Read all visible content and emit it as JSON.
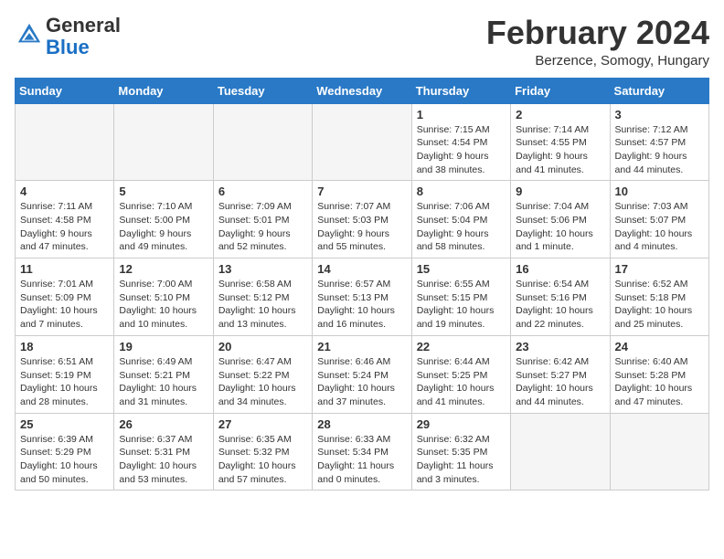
{
  "header": {
    "logo_line1": "General",
    "logo_line2": "Blue",
    "month_title": "February 2024",
    "location": "Berzence, Somogy, Hungary"
  },
  "weekdays": [
    "Sunday",
    "Monday",
    "Tuesday",
    "Wednesday",
    "Thursday",
    "Friday",
    "Saturday"
  ],
  "weeks": [
    [
      {
        "day": "",
        "info": ""
      },
      {
        "day": "",
        "info": ""
      },
      {
        "day": "",
        "info": ""
      },
      {
        "day": "",
        "info": ""
      },
      {
        "day": "1",
        "info": "Sunrise: 7:15 AM\nSunset: 4:54 PM\nDaylight: 9 hours\nand 38 minutes."
      },
      {
        "day": "2",
        "info": "Sunrise: 7:14 AM\nSunset: 4:55 PM\nDaylight: 9 hours\nand 41 minutes."
      },
      {
        "day": "3",
        "info": "Sunrise: 7:12 AM\nSunset: 4:57 PM\nDaylight: 9 hours\nand 44 minutes."
      }
    ],
    [
      {
        "day": "4",
        "info": "Sunrise: 7:11 AM\nSunset: 4:58 PM\nDaylight: 9 hours\nand 47 minutes."
      },
      {
        "day": "5",
        "info": "Sunrise: 7:10 AM\nSunset: 5:00 PM\nDaylight: 9 hours\nand 49 minutes."
      },
      {
        "day": "6",
        "info": "Sunrise: 7:09 AM\nSunset: 5:01 PM\nDaylight: 9 hours\nand 52 minutes."
      },
      {
        "day": "7",
        "info": "Sunrise: 7:07 AM\nSunset: 5:03 PM\nDaylight: 9 hours\nand 55 minutes."
      },
      {
        "day": "8",
        "info": "Sunrise: 7:06 AM\nSunset: 5:04 PM\nDaylight: 9 hours\nand 58 minutes."
      },
      {
        "day": "9",
        "info": "Sunrise: 7:04 AM\nSunset: 5:06 PM\nDaylight: 10 hours\nand 1 minute."
      },
      {
        "day": "10",
        "info": "Sunrise: 7:03 AM\nSunset: 5:07 PM\nDaylight: 10 hours\nand 4 minutes."
      }
    ],
    [
      {
        "day": "11",
        "info": "Sunrise: 7:01 AM\nSunset: 5:09 PM\nDaylight: 10 hours\nand 7 minutes."
      },
      {
        "day": "12",
        "info": "Sunrise: 7:00 AM\nSunset: 5:10 PM\nDaylight: 10 hours\nand 10 minutes."
      },
      {
        "day": "13",
        "info": "Sunrise: 6:58 AM\nSunset: 5:12 PM\nDaylight: 10 hours\nand 13 minutes."
      },
      {
        "day": "14",
        "info": "Sunrise: 6:57 AM\nSunset: 5:13 PM\nDaylight: 10 hours\nand 16 minutes."
      },
      {
        "day": "15",
        "info": "Sunrise: 6:55 AM\nSunset: 5:15 PM\nDaylight: 10 hours\nand 19 minutes."
      },
      {
        "day": "16",
        "info": "Sunrise: 6:54 AM\nSunset: 5:16 PM\nDaylight: 10 hours\nand 22 minutes."
      },
      {
        "day": "17",
        "info": "Sunrise: 6:52 AM\nSunset: 5:18 PM\nDaylight: 10 hours\nand 25 minutes."
      }
    ],
    [
      {
        "day": "18",
        "info": "Sunrise: 6:51 AM\nSunset: 5:19 PM\nDaylight: 10 hours\nand 28 minutes."
      },
      {
        "day": "19",
        "info": "Sunrise: 6:49 AM\nSunset: 5:21 PM\nDaylight: 10 hours\nand 31 minutes."
      },
      {
        "day": "20",
        "info": "Sunrise: 6:47 AM\nSunset: 5:22 PM\nDaylight: 10 hours\nand 34 minutes."
      },
      {
        "day": "21",
        "info": "Sunrise: 6:46 AM\nSunset: 5:24 PM\nDaylight: 10 hours\nand 37 minutes."
      },
      {
        "day": "22",
        "info": "Sunrise: 6:44 AM\nSunset: 5:25 PM\nDaylight: 10 hours\nand 41 minutes."
      },
      {
        "day": "23",
        "info": "Sunrise: 6:42 AM\nSunset: 5:27 PM\nDaylight: 10 hours\nand 44 minutes."
      },
      {
        "day": "24",
        "info": "Sunrise: 6:40 AM\nSunset: 5:28 PM\nDaylight: 10 hours\nand 47 minutes."
      }
    ],
    [
      {
        "day": "25",
        "info": "Sunrise: 6:39 AM\nSunset: 5:29 PM\nDaylight: 10 hours\nand 50 minutes."
      },
      {
        "day": "26",
        "info": "Sunrise: 6:37 AM\nSunset: 5:31 PM\nDaylight: 10 hours\nand 53 minutes."
      },
      {
        "day": "27",
        "info": "Sunrise: 6:35 AM\nSunset: 5:32 PM\nDaylight: 10 hours\nand 57 minutes."
      },
      {
        "day": "28",
        "info": "Sunrise: 6:33 AM\nSunset: 5:34 PM\nDaylight: 11 hours\nand 0 minutes."
      },
      {
        "day": "29",
        "info": "Sunrise: 6:32 AM\nSunset: 5:35 PM\nDaylight: 11 hours\nand 3 minutes."
      },
      {
        "day": "",
        "info": ""
      },
      {
        "day": "",
        "info": ""
      }
    ]
  ]
}
